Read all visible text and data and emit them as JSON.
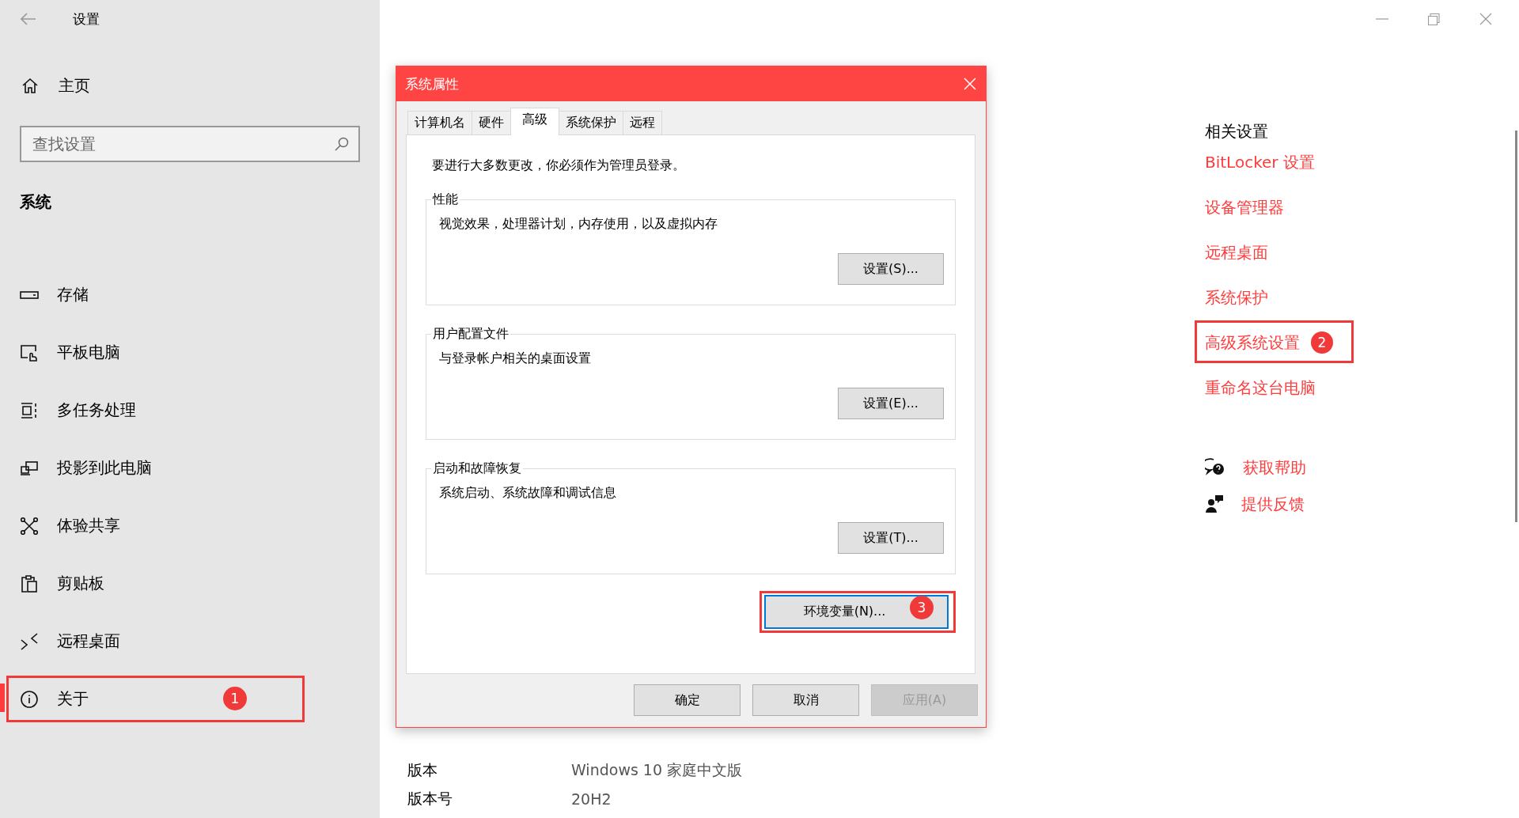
{
  "sidebar": {
    "title": "设置",
    "home": "主页",
    "search": {
      "placeholder": "查找设置"
    },
    "section": "系统",
    "items": [
      {
        "label": "存储",
        "selected": false
      },
      {
        "label": "平板电脑",
        "selected": false
      },
      {
        "label": "多任务处理",
        "selected": false
      },
      {
        "label": "投影到此电脑",
        "selected": false
      },
      {
        "label": "体验共享",
        "selected": false
      },
      {
        "label": "剪贴板",
        "selected": false
      },
      {
        "label": "远程桌面",
        "selected": false
      },
      {
        "label": "关于",
        "selected": true,
        "badge": "1"
      }
    ]
  },
  "dialog": {
    "title": "系统属性",
    "tabs": [
      {
        "label": "计算机名",
        "selected": false
      },
      {
        "label": "硬件",
        "selected": false
      },
      {
        "label": "高级",
        "selected": true
      },
      {
        "label": "系统保护",
        "selected": false
      },
      {
        "label": "远程",
        "selected": false
      }
    ],
    "notice": "要进行大多数更改，你必须作为管理员登录。",
    "groups": [
      {
        "title": "性能",
        "description": "视觉效果，处理器计划，内存使用，以及虚拟内存",
        "button": "设置(S)..."
      },
      {
        "title": "用户配置文件",
        "description": "与登录帐户相关的桌面设置",
        "button": "设置(E)..."
      },
      {
        "title": "启动和故障恢复",
        "description": "系统启动、系统故障和调试信息",
        "button": "设置(T)..."
      }
    ],
    "env_button": {
      "label": "环境变量(N)...",
      "badge": "3",
      "focused": true
    },
    "buttons": [
      {
        "label": "确定",
        "disabled": false
      },
      {
        "label": "取消",
        "disabled": false
      },
      {
        "label": "应用(A)",
        "disabled": true
      }
    ]
  },
  "about": {
    "rows": [
      {
        "label": "版本",
        "value": "Windows 10 家庭中文版"
      },
      {
        "label": "版本号",
        "value": "20H2"
      }
    ]
  },
  "related": {
    "title": "相关设置",
    "links": [
      {
        "label": "BitLocker 设置"
      },
      {
        "label": "设备管理器"
      },
      {
        "label": "远程桌面"
      },
      {
        "label": "系统保护"
      },
      {
        "label": "高级系统设置",
        "badge": "2"
      },
      {
        "label": "重命名这台电脑"
      }
    ],
    "help": [
      {
        "label": "获取帮助"
      },
      {
        "label": "提供反馈"
      }
    ]
  }
}
